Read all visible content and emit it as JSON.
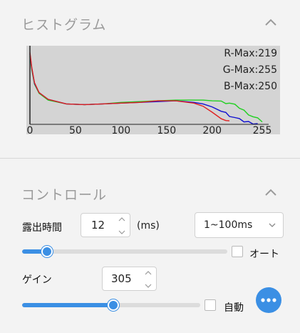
{
  "histogram": {
    "title": "ヒストグラム",
    "stats": [
      "R-Max:219",
      "G-Max:255",
      "B-Max:250"
    ],
    "x_ticks": [
      "0",
      "50",
      "100",
      "150",
      "200",
      "255"
    ]
  },
  "control": {
    "title": "コントロール",
    "exposure": {
      "label": "露出時間",
      "value": "12",
      "unit": "(ms)",
      "range_selected": "1~100ms",
      "slider_fraction": 0.12,
      "auto_label": "オート"
    },
    "gain": {
      "label": "ゲイン",
      "value": "305",
      "slider_fraction": 0.51,
      "auto_label": "自動"
    }
  },
  "chart_data": {
    "type": "line",
    "x": [
      0,
      2,
      5,
      10,
      20,
      40,
      60,
      80,
      100,
      120,
      140,
      160,
      180,
      190,
      200,
      210,
      215,
      219,
      225,
      230,
      235,
      240,
      245,
      250,
      255
    ],
    "series": [
      {
        "name": "R",
        "color": "#e02020",
        "values": [
          0.95,
          0.75,
          0.55,
          0.42,
          0.33,
          0.27,
          0.26,
          0.27,
          0.28,
          0.29,
          0.31,
          0.31,
          0.28,
          0.24,
          0.16,
          0.09,
          0.05,
          0.03,
          null,
          null,
          null,
          null,
          null,
          null,
          null
        ]
      },
      {
        "name": "G",
        "color": "#20d020",
        "values": [
          0.9,
          0.72,
          0.53,
          0.41,
          0.32,
          0.27,
          0.26,
          0.27,
          0.29,
          0.3,
          0.31,
          0.32,
          0.32,
          0.32,
          0.31,
          0.3,
          0.29,
          0.28,
          0.25,
          0.22,
          0.18,
          0.14,
          0.1,
          0.07,
          0.04
        ]
      },
      {
        "name": "B",
        "color": "#1010d0",
        "values": [
          0.93,
          0.74,
          0.54,
          0.42,
          0.33,
          0.27,
          0.26,
          0.27,
          0.28,
          0.29,
          0.3,
          0.31,
          0.29,
          0.27,
          0.23,
          0.18,
          0.15,
          0.12,
          0.09,
          0.06,
          0.04,
          0.03,
          0.02,
          0.01,
          null
        ]
      }
    ],
    "xlim": [
      0,
      255
    ],
    "ylim": [
      0,
      1
    ],
    "grid": false
  }
}
